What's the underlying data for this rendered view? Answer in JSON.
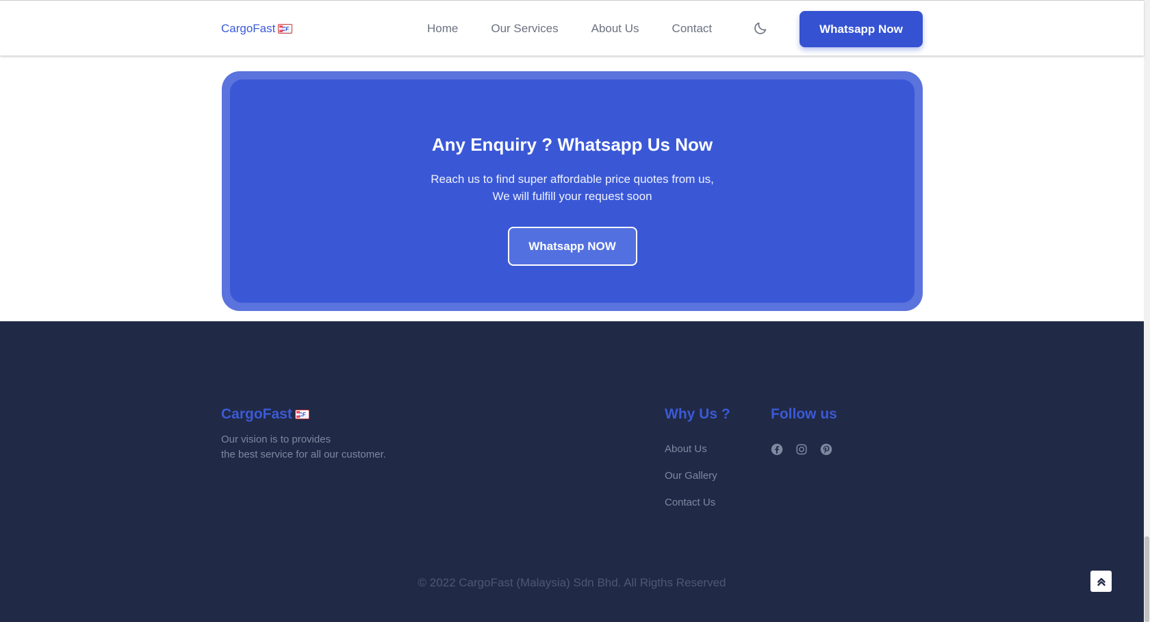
{
  "header": {
    "logo_text": "CargoFast",
    "logo_badge": "CF",
    "nav": [
      "Home",
      "Our Services",
      "About Us",
      "Contact"
    ],
    "theme_toggle_icon": "moon-icon",
    "cta_label": "Whatsapp Now",
    "accent_color": "#3452d1"
  },
  "cta_section": {
    "title": "Any Enquiry ? Whatsapp Us Now",
    "text": "Reach us to find super affordable price quotes from us, We will fulfill your request soon",
    "button_label": "Whatsapp NOW",
    "bg_color": "#3a58d6"
  },
  "footer": {
    "logo_text": "CargoFast",
    "logo_badge": "CF",
    "vision_line1": "Our vision is to provides",
    "vision_line2": "the best service for all our customer.",
    "why_heading": "Why Us ?",
    "why_links": [
      "About Us",
      "Our Gallery",
      "Contact Us"
    ],
    "follow_heading": "Follow us",
    "socials": [
      "facebook-icon",
      "instagram-icon",
      "pinterest-icon"
    ],
    "copyright": "© 2022 CargoFast (Malaysia) Sdn Bhd. All Rigths Reserved",
    "bg_color": "#202946"
  },
  "back_to_top_icon": "double-chevron-up-icon"
}
